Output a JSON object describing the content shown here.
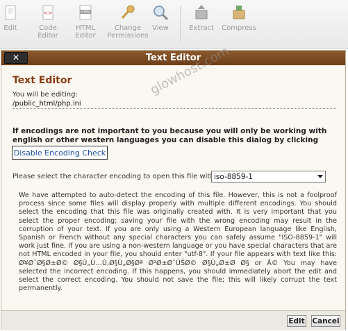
{
  "toolbar": {
    "items": [
      {
        "label": "Edit",
        "icon": "edit-icon"
      },
      {
        "label": "Code\nEditor",
        "icon": "code-editor-icon"
      },
      {
        "label": "HTML\nEditor",
        "icon": "html-editor-icon"
      },
      {
        "label": "Change\nPermissions",
        "icon": "key-icon"
      },
      {
        "label": "View",
        "icon": "magnifier-icon"
      },
      {
        "label": "Extract",
        "icon": "extract-icon"
      },
      {
        "label": "Compress",
        "icon": "compress-icon"
      }
    ]
  },
  "dialog": {
    "title": "Text Editor",
    "close_label": "✕",
    "heading": "Text Editor",
    "editing_label": "You will be editing:",
    "path": "/public_html/php.ini",
    "warning": "If encodings are not important to you because you will only be working with english or other western languages you can disable this dialog by clicking here:",
    "disable_button": "Disable Encoding Check",
    "select_label": "Please select the character encoding to open this file with:",
    "select_value": "iso-8859-1",
    "paragraph": "We have attempted to auto-detect the encoding of this file. However, this is not a foolproof process since some files will display properly with multiple different encodings. You should select the encoding that this file was originally created with. It is very important that you select the proper encoding; saving your file with the wrong encoding may result in the corruption of your text. If you are only using a Western European language like English, Spanish or French without any special characters you can safely assume \"ISO-8859-1\" will work just fine. If you are using a non-western language or you have special characters that are not HTML encoded in your file, you should enter \"utf-8\". If your file appears with text like this: Ø¥Ø¯Ø§Ø±Ø© Ø§Ù„Ù…Ù‚Ø§Ù„Ø§Øª Ø¹Ø±Ø¨ÙŠØ© Ø§Ù„Ø±Ø­ Ø§ or Â© You may have selected the incorrect encoding. If this happens, you should immediately abort the edit and select the correct encoding. You should not save the file; this will likely corrupt the text permanently.",
    "edit_button": "Edit",
    "cancel_button": "Cancel"
  },
  "watermark": "glowhost.com"
}
